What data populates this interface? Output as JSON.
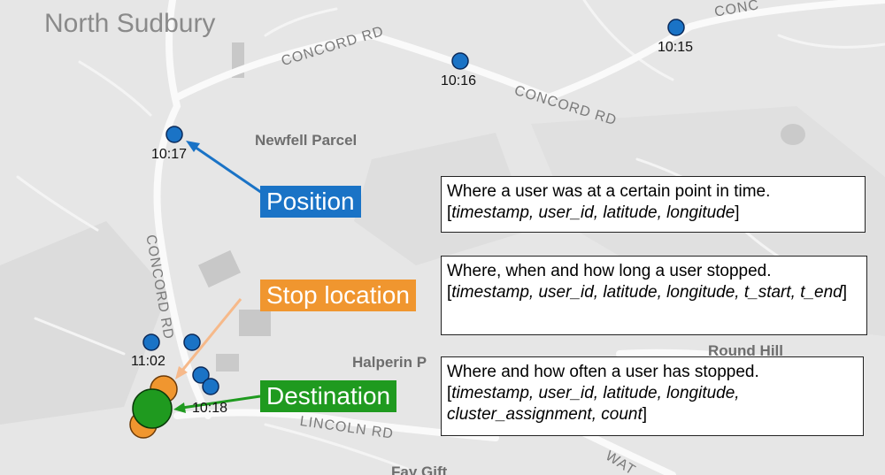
{
  "map": {
    "place_labels": {
      "north_sudbury": "North Sudbury",
      "newfell_parcel": "Newfell Parcel",
      "halperin": "Halperin P",
      "round_hill": "Round Hill",
      "fay_gift": "Fay Gift"
    },
    "road_labels": {
      "concord_rd_top_right": "CONC",
      "concord_rd_1": "CONCORD RD",
      "concord_rd_2": "CONCORD RD",
      "concord_rd_vertical": "CONCORD RD",
      "lincoln_rd": "LINCOLN RD",
      "wat": "WAT"
    }
  },
  "points": {
    "p1015": "10:15",
    "p1016": "10:16",
    "p1017": "10:17",
    "p1102": "11:02",
    "p1018": "10:18"
  },
  "legend": {
    "position": {
      "label": "Position",
      "color": "#1a73c6",
      "bracket_open": "[",
      "fields": "timestamp, user_id, latitude, longitude",
      "bracket_close": "]",
      "description": "Where a user was at a certain point in time."
    },
    "stop": {
      "label": "Stop location",
      "color": "#f0962f",
      "bracket_open": "[",
      "fields": "timestamp, user_id, latitude, longitude, t_start, t_end",
      "bracket_close": "]",
      "description": "Where, when and how long a user stopped."
    },
    "destination": {
      "label": "Destination",
      "color": "#1f9a1f",
      "bracket_open": "[",
      "fields": "timestamp, user_id, latitude, longitude, cluster_assignment, count",
      "bracket_close": "]",
      "description": "Where and how often a user has stopped."
    }
  }
}
